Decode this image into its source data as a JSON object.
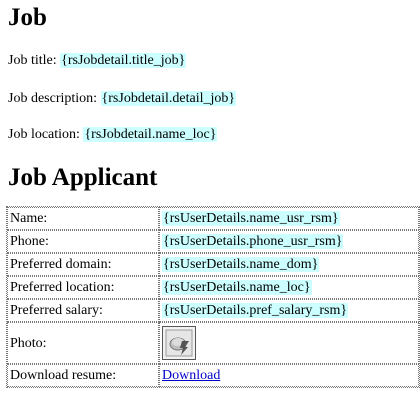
{
  "job": {
    "heading": "Job",
    "title_label": "Job title:",
    "title_value": "{rsJobdetail.title_job}",
    "description_label": "Job description:",
    "description_value": "{rsJobdetail.detail_job}",
    "location_label": "Job location:",
    "location_value": "{rsJobdetail.name_loc}"
  },
  "applicant": {
    "heading": "Job Applicant",
    "rows": [
      {
        "label": "Name:",
        "value": "{rsUserDetails.name_usr_rsm}"
      },
      {
        "label": "Phone:",
        "value": "{rsUserDetails.phone_usr_rsm}"
      },
      {
        "label": "Preferred domain:",
        "value": "{rsUserDetails.name_dom}"
      },
      {
        "label": "Preferred location:",
        "value": "{rsUserDetails.name_loc}"
      },
      {
        "label": "Preferred salary:",
        "value": "{rsUserDetails.pref_salary_rsm}"
      }
    ],
    "photo_label": "Photo:",
    "photo_icon": "image-placeholder-icon",
    "resume_label": "Download resume:",
    "resume_link": "Download"
  },
  "colors": {
    "binding_highlight": "#ccffff",
    "link": "#0000cc",
    "table_border": "#777777"
  }
}
